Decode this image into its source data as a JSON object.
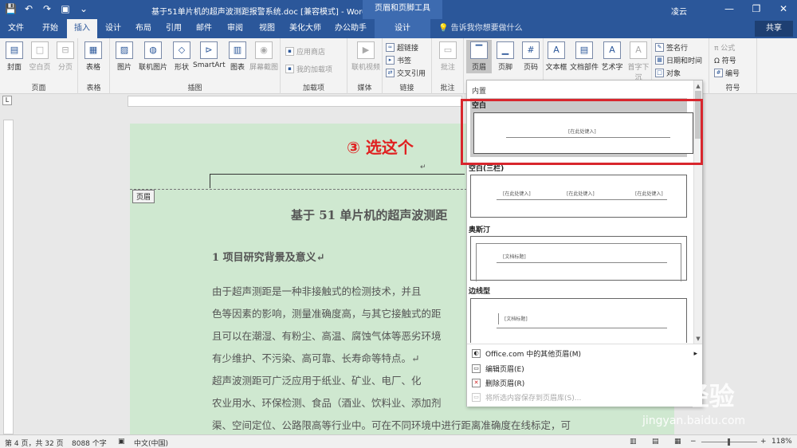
{
  "window": {
    "title": "基于51单片机的超声波测距报警系统.doc [兼容模式] - Word",
    "context_tools": "页眉和页脚工具",
    "user": "凌云",
    "controls": {
      "minimize": "—",
      "restore": "❐",
      "close": "✕"
    }
  },
  "quick_access": [
    "💾",
    "↶",
    "↷",
    "▣",
    "⌄"
  ],
  "tabs": [
    "文件",
    "开始",
    "插入",
    "设计",
    "布局",
    "引用",
    "邮件",
    "审阅",
    "视图",
    "美化大师",
    "办公助手",
    "设计"
  ],
  "active_tab": "插入",
  "tell_me": "💡 告诉我你想要做什么",
  "share": "共享",
  "ribbon": {
    "groups": [
      "页面",
      "表格",
      "插图",
      "加载项",
      "媒体",
      "链接",
      "批注",
      "符号"
    ],
    "buttons": {
      "cover": "封面",
      "blank_page": "空白页",
      "page_break": "分页",
      "table": "表格",
      "picture": "图片",
      "online_picture": "联机图片",
      "shapes": "形状",
      "smartart": "SmartArt",
      "chart": "图表",
      "screenshot": "屏幕截图",
      "store": "应用商店",
      "my_addins": "我的加载项",
      "online_video": "联机视频",
      "hyperlink": "超链接",
      "bookmark": "书签",
      "cross_ref": "交叉引用",
      "comment": "批注",
      "header": "页眉",
      "footer": "页脚",
      "page_number": "页码",
      "textbox": "文本框",
      "doc_parts": "文档部件",
      "wordart": "艺术字",
      "dropcap": "首字下沉",
      "signature": "签名行",
      "datetime": "日期和时间",
      "object": "对象",
      "equation": "π 公式",
      "symbol": "Ω 符号",
      "numbering": "编号"
    }
  },
  "document": {
    "step_annotation": "③ 选这个",
    "header_tag": "页眉",
    "paragraph_mark": "↵",
    "title": "基于 51 单片机的超声波测距",
    "heading": "1  项目研究背景及意义↵",
    "lines": [
      "    由于超声测距是一种非接触式的检测技术，并且",
      "色等因素的影响，测量准确度高，与其它接触式的距",
      "且可以在潮湿、有粉尘、高温、腐蚀气体等恶劣环境",
      "有少维护、不污染、高可靠、长寿命等特点。↵",
      "    超声波测距可广泛应用于纸业、矿业、电厂、化",
      "农业用水、环保检测、食品（酒业、饮料业、添加剂",
      "渠、空间定位、公路限高等行业中。可在不同环境中进行距离准确度在线标定，可"
    ]
  },
  "gallery": {
    "header": "内置",
    "items": [
      {
        "name": "空白",
        "placeholders": [
          "[在此处键入]"
        ]
      },
      {
        "name": "空白(三栏)",
        "placeholders": [
          "[在此处键入]",
          "[在此处键入]",
          "[在此处键入]"
        ]
      },
      {
        "name": "奥斯汀",
        "placeholders": [
          "[文档标题]"
        ]
      },
      {
        "name": "边线型",
        "placeholders": [
          "[文档标题]"
        ]
      }
    ],
    "menu": [
      {
        "label": "Office.com 中的其他页眉(M)",
        "arrow": "▸"
      },
      {
        "label": "编辑页眉(E)"
      },
      {
        "label": "删除页眉(R)"
      },
      {
        "label": "将所选内容保存到页眉库(S)..."
      }
    ]
  },
  "statusbar": {
    "page": "第 4 页，共 32 页",
    "words": "8088 个字",
    "lang": "中文(中国)",
    "zoom": "118%",
    "zoom_minus": "−",
    "zoom_plus": "+"
  },
  "watermark": {
    "brand": "Baidu经验",
    "url": "jingyan.baidu.com"
  }
}
